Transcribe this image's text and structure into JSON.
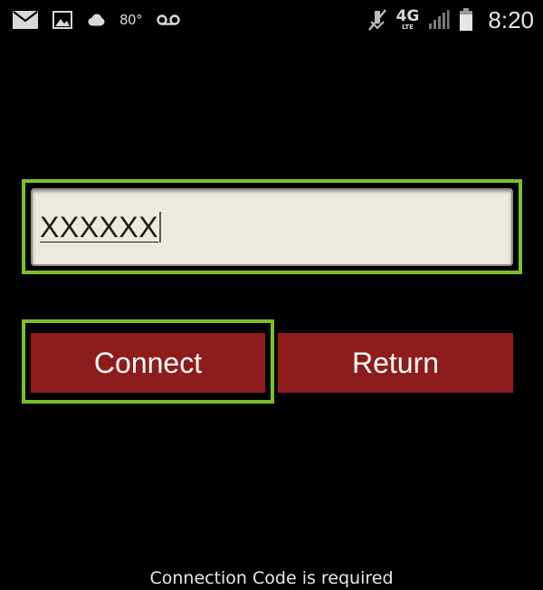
{
  "status_bar": {
    "temperature": "80°",
    "network": "4G",
    "network_sub": "LTE",
    "time": "8:20",
    "icons": [
      "mail-icon",
      "image-icon",
      "cloud-icon",
      "voicemail-icon",
      "mute-icon",
      "signal-icon",
      "battery-icon"
    ]
  },
  "form": {
    "code_value": "XXXXXX",
    "connect_label": "Connect",
    "return_label": "Return"
  },
  "message": "Connection Code is required",
  "colors": {
    "background": "#000000",
    "button": "#8d1c1d",
    "input_bg": "#ece9e0",
    "highlight": "#7cbf2c"
  }
}
